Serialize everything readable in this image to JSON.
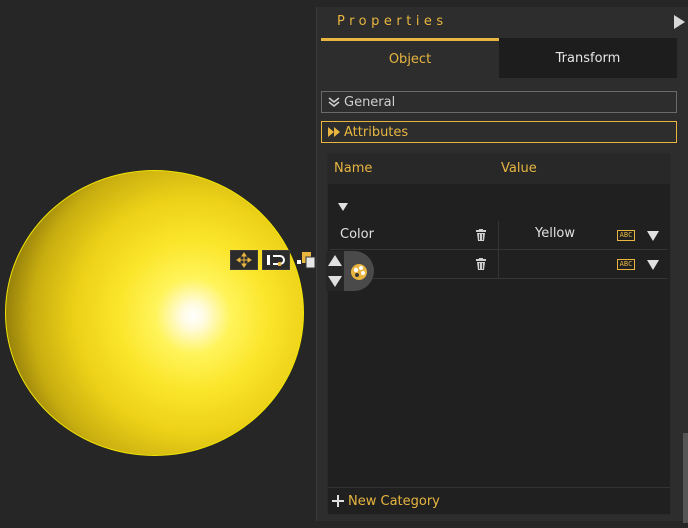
{
  "panel": {
    "title": "Properties",
    "tabs": [
      {
        "label": "Object",
        "active": true
      },
      {
        "label": "Transform",
        "active": false
      }
    ],
    "sections": [
      {
        "label": "General",
        "expanded": false
      },
      {
        "label": "Attributes",
        "expanded": true
      }
    ],
    "table": {
      "headers": {
        "name": "Name",
        "value": "Value"
      },
      "rows": [
        {
          "name": "Color",
          "value": "Yellow"
        },
        {
          "name": "",
          "value": ""
        }
      ],
      "add_category": "New Category"
    }
  },
  "gizmo_icons": [
    "move-icon",
    "magnet-icon",
    "layer-icon"
  ],
  "colors": {
    "accent": "#e8b640",
    "sphere": "#f2e600",
    "background": "#262626",
    "panel": "#2d2d2d"
  }
}
